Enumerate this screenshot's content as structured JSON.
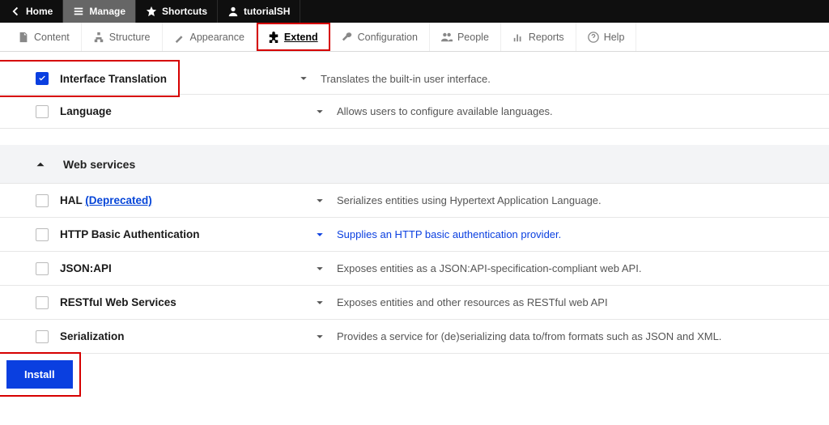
{
  "topbar": {
    "home": "Home",
    "manage": "Manage",
    "shortcuts": "Shortcuts",
    "user": "tutorialSH"
  },
  "tabs": {
    "content": "Content",
    "structure": "Structure",
    "appearance": "Appearance",
    "extend": "Extend",
    "configuration": "Configuration",
    "people": "People",
    "reports": "Reports",
    "help": "Help"
  },
  "modules": {
    "interface_translation": {
      "name": "Interface Translation",
      "desc": "Translates the built-in user interface."
    },
    "language": {
      "name": "Language",
      "desc": "Allows users to configure available languages."
    }
  },
  "group": {
    "title": "Web services"
  },
  "web": {
    "hal": {
      "name": "HAL ",
      "dep": "(Deprecated)",
      "desc": "Serializes entities using Hypertext Application Language."
    },
    "http_basic": {
      "name": "HTTP Basic Authentication",
      "desc": "Supplies an HTTP basic authentication provider."
    },
    "jsonapi": {
      "name": "JSON:API",
      "desc": "Exposes entities as a JSON:API-specification-compliant web API."
    },
    "rest": {
      "name": "RESTful Web Services",
      "desc": "Exposes entities and other resources as RESTful web API"
    },
    "serialization": {
      "name": "Serialization",
      "desc": "Provides a service for (de)serializing data to/from formats such as JSON and XML."
    }
  },
  "actions": {
    "install": "Install"
  }
}
